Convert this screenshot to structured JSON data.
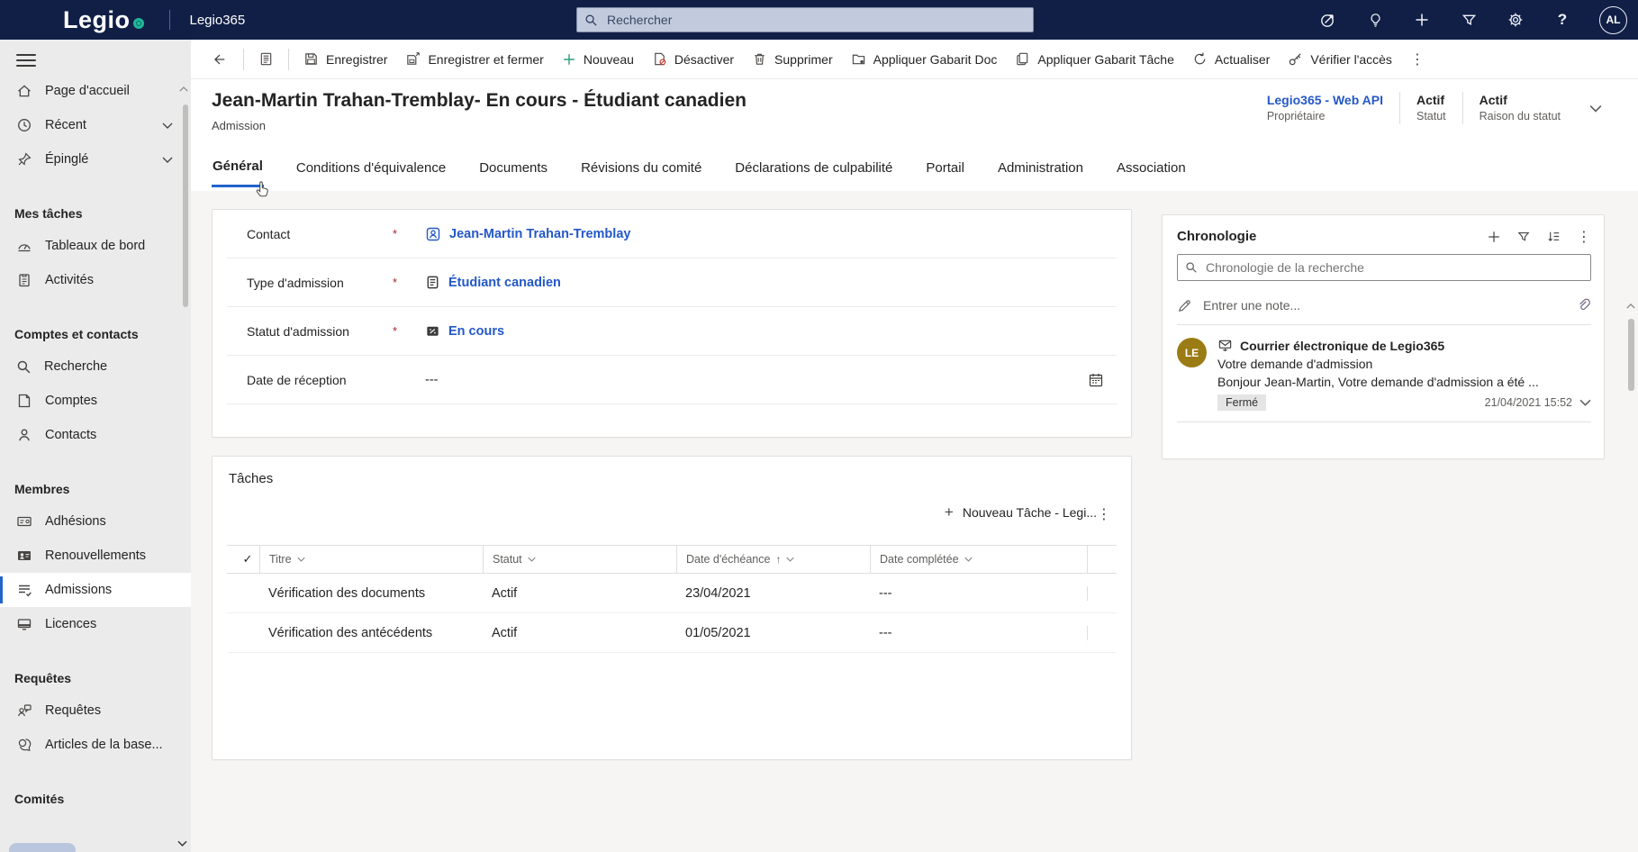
{
  "topbar": {
    "logo_text": "Legio",
    "app_name": "Legio365",
    "search_placeholder": "Rechercher",
    "help_glyph": "?",
    "avatar_initials": "AL",
    "colors": {
      "bar": "#111f47",
      "logo_dot_teal": "#1eb79b"
    }
  },
  "command_bar": {
    "buttons": [
      {
        "label": "Enregistrer",
        "icon": "save-icon"
      },
      {
        "label": "Enregistrer et fermer",
        "icon": "save-close-icon"
      },
      {
        "label": "Nouveau",
        "icon": "plus-icon"
      },
      {
        "label": "Désactiver",
        "icon": "deactivate-icon"
      },
      {
        "label": "Supprimer",
        "icon": "delete-icon"
      },
      {
        "label": "Appliquer Gabarit Doc",
        "icon": "apply-doc-template-icon"
      },
      {
        "label": "Appliquer Gabarit Tâche",
        "icon": "apply-task-template-icon"
      },
      {
        "label": "Actualiser",
        "icon": "refresh-icon"
      },
      {
        "label": "Vérifier l'accès",
        "icon": "key-icon"
      }
    ],
    "overflow_glyph": "⋮"
  },
  "sidebar": {
    "groups": [
      {
        "header": "",
        "items": [
          {
            "label": "Page d'accueil",
            "icon": "home-icon"
          },
          {
            "label": "Récent",
            "icon": "clock-icon"
          },
          {
            "label": "Épinglé",
            "icon": "pin-icon"
          }
        ]
      },
      {
        "header": "Mes tâches",
        "items": [
          {
            "label": "Tableaux de bord",
            "icon": "dashboard-icon"
          },
          {
            "label": "Activités",
            "icon": "clipboard-icon"
          }
        ]
      },
      {
        "header": "Comptes et contacts",
        "items": [
          {
            "label": "Recherche",
            "icon": "search-icon"
          },
          {
            "label": "Comptes",
            "icon": "accounts-icon"
          },
          {
            "label": "Contacts",
            "icon": "person-icon"
          }
        ]
      },
      {
        "header": "Membres",
        "items": [
          {
            "label": "Adhésions",
            "icon": "membership-card-icon"
          },
          {
            "label": "Renouvellements",
            "icon": "renewals-card-icon"
          },
          {
            "label": "Admissions",
            "icon": "admissions-list-icon",
            "selected": true
          },
          {
            "label": "Licences",
            "icon": "licences-icon"
          }
        ]
      },
      {
        "header": "Requêtes",
        "items": [
          {
            "label": "Requêtes",
            "icon": "requests-icon"
          },
          {
            "label": "Articles de la base...",
            "icon": "knowledge-icon"
          }
        ]
      },
      {
        "header": "Comités",
        "items": []
      }
    ]
  },
  "record_header": {
    "title": "Jean-Martin Trahan-Tremblay- En cours - Étudiant canadien",
    "entity": "Admission",
    "owner_value": "Legio365 - Web API",
    "owner_label": "Propriétaire",
    "status_value": "Actif",
    "status_label": "Statut",
    "status_reason_value": "Actif",
    "status_reason_label": "Raison du statut"
  },
  "tabs": {
    "selected": "Général",
    "items": [
      {
        "label": "Général"
      },
      {
        "label": "Conditions d'équivalence"
      },
      {
        "label": "Documents"
      },
      {
        "label": "Révisions du comité"
      },
      {
        "label": "Déclarations de culpabilité"
      },
      {
        "label": "Portail"
      },
      {
        "label": "Administration"
      },
      {
        "label": "Association"
      }
    ]
  },
  "form": {
    "fields": [
      {
        "label": "Contact",
        "required": "*",
        "value": "Jean-Martin Trahan-Tremblay",
        "icon": "contact-badge-icon"
      },
      {
        "label": "Type d'admission",
        "required": "*",
        "value": "Étudiant canadien",
        "icon": "document-icon"
      },
      {
        "label": "Statut d'admission",
        "required": "*",
        "value": "En cours",
        "icon": "status-icon"
      },
      {
        "label": "Date de réception",
        "required": "",
        "value": "---",
        "icon": "calendar-icon"
      }
    ]
  },
  "timeline": {
    "title": "Chronologie",
    "search_placeholder": "Chronologie de la recherche",
    "note_placeholder": "Entrer une note...",
    "entries": [
      {
        "avatar_initials": "LE",
        "title": "Courrier électronique de Legio365",
        "subject": "Votre demande d'admission",
        "preview": "Bonjour Jean-Martin,   Votre demande d'admission a été ...",
        "status_badge": "Fermé",
        "timestamp": "21/04/2021 15:52"
      }
    ]
  },
  "tasks": {
    "title": "Tâches",
    "new_button_label": "Nouveau Tâche - Legi...",
    "columns": [
      {
        "label": "Titre",
        "sort_arrow": ""
      },
      {
        "label": "Statut",
        "sort_arrow": ""
      },
      {
        "label": "Date d'échéance",
        "sort_arrow": "↑"
      },
      {
        "label": "Date complétée",
        "sort_arrow": ""
      }
    ],
    "header_check_glyph": "✓",
    "rows": [
      {
        "title": "Vérification des documents",
        "status": "Actif",
        "due_date": "23/04/2021",
        "completed_date": "---"
      },
      {
        "title": "Vérification des antécédents",
        "status": "Actif",
        "due_date": "01/05/2021",
        "completed_date": "---"
      }
    ]
  }
}
